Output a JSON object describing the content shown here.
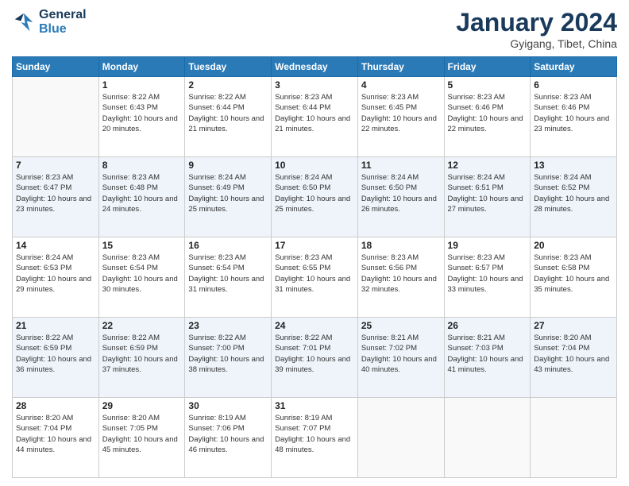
{
  "header": {
    "logo_line1": "General",
    "logo_line2": "Blue",
    "month_title": "January 2024",
    "location": "Gyigang, Tibet, China"
  },
  "days_of_week": [
    "Sunday",
    "Monday",
    "Tuesday",
    "Wednesday",
    "Thursday",
    "Friday",
    "Saturday"
  ],
  "weeks": [
    [
      {
        "day": "",
        "sunrise": "",
        "sunset": "",
        "daylight": ""
      },
      {
        "day": "1",
        "sunrise": "Sunrise: 8:22 AM",
        "sunset": "Sunset: 6:43 PM",
        "daylight": "Daylight: 10 hours and 20 minutes."
      },
      {
        "day": "2",
        "sunrise": "Sunrise: 8:22 AM",
        "sunset": "Sunset: 6:44 PM",
        "daylight": "Daylight: 10 hours and 21 minutes."
      },
      {
        "day": "3",
        "sunrise": "Sunrise: 8:23 AM",
        "sunset": "Sunset: 6:44 PM",
        "daylight": "Daylight: 10 hours and 21 minutes."
      },
      {
        "day": "4",
        "sunrise": "Sunrise: 8:23 AM",
        "sunset": "Sunset: 6:45 PM",
        "daylight": "Daylight: 10 hours and 22 minutes."
      },
      {
        "day": "5",
        "sunrise": "Sunrise: 8:23 AM",
        "sunset": "Sunset: 6:46 PM",
        "daylight": "Daylight: 10 hours and 22 minutes."
      },
      {
        "day": "6",
        "sunrise": "Sunrise: 8:23 AM",
        "sunset": "Sunset: 6:46 PM",
        "daylight": "Daylight: 10 hours and 23 minutes."
      }
    ],
    [
      {
        "day": "7",
        "sunrise": "Sunrise: 8:23 AM",
        "sunset": "Sunset: 6:47 PM",
        "daylight": "Daylight: 10 hours and 23 minutes."
      },
      {
        "day": "8",
        "sunrise": "Sunrise: 8:23 AM",
        "sunset": "Sunset: 6:48 PM",
        "daylight": "Daylight: 10 hours and 24 minutes."
      },
      {
        "day": "9",
        "sunrise": "Sunrise: 8:24 AM",
        "sunset": "Sunset: 6:49 PM",
        "daylight": "Daylight: 10 hours and 25 minutes."
      },
      {
        "day": "10",
        "sunrise": "Sunrise: 8:24 AM",
        "sunset": "Sunset: 6:50 PM",
        "daylight": "Daylight: 10 hours and 25 minutes."
      },
      {
        "day": "11",
        "sunrise": "Sunrise: 8:24 AM",
        "sunset": "Sunset: 6:50 PM",
        "daylight": "Daylight: 10 hours and 26 minutes."
      },
      {
        "day": "12",
        "sunrise": "Sunrise: 8:24 AM",
        "sunset": "Sunset: 6:51 PM",
        "daylight": "Daylight: 10 hours and 27 minutes."
      },
      {
        "day": "13",
        "sunrise": "Sunrise: 8:24 AM",
        "sunset": "Sunset: 6:52 PM",
        "daylight": "Daylight: 10 hours and 28 minutes."
      }
    ],
    [
      {
        "day": "14",
        "sunrise": "Sunrise: 8:24 AM",
        "sunset": "Sunset: 6:53 PM",
        "daylight": "Daylight: 10 hours and 29 minutes."
      },
      {
        "day": "15",
        "sunrise": "Sunrise: 8:23 AM",
        "sunset": "Sunset: 6:54 PM",
        "daylight": "Daylight: 10 hours and 30 minutes."
      },
      {
        "day": "16",
        "sunrise": "Sunrise: 8:23 AM",
        "sunset": "Sunset: 6:54 PM",
        "daylight": "Daylight: 10 hours and 31 minutes."
      },
      {
        "day": "17",
        "sunrise": "Sunrise: 8:23 AM",
        "sunset": "Sunset: 6:55 PM",
        "daylight": "Daylight: 10 hours and 31 minutes."
      },
      {
        "day": "18",
        "sunrise": "Sunrise: 8:23 AM",
        "sunset": "Sunset: 6:56 PM",
        "daylight": "Daylight: 10 hours and 32 minutes."
      },
      {
        "day": "19",
        "sunrise": "Sunrise: 8:23 AM",
        "sunset": "Sunset: 6:57 PM",
        "daylight": "Daylight: 10 hours and 33 minutes."
      },
      {
        "day": "20",
        "sunrise": "Sunrise: 8:23 AM",
        "sunset": "Sunset: 6:58 PM",
        "daylight": "Daylight: 10 hours and 35 minutes."
      }
    ],
    [
      {
        "day": "21",
        "sunrise": "Sunrise: 8:22 AM",
        "sunset": "Sunset: 6:59 PM",
        "daylight": "Daylight: 10 hours and 36 minutes."
      },
      {
        "day": "22",
        "sunrise": "Sunrise: 8:22 AM",
        "sunset": "Sunset: 6:59 PM",
        "daylight": "Daylight: 10 hours and 37 minutes."
      },
      {
        "day": "23",
        "sunrise": "Sunrise: 8:22 AM",
        "sunset": "Sunset: 7:00 PM",
        "daylight": "Daylight: 10 hours and 38 minutes."
      },
      {
        "day": "24",
        "sunrise": "Sunrise: 8:22 AM",
        "sunset": "Sunset: 7:01 PM",
        "daylight": "Daylight: 10 hours and 39 minutes."
      },
      {
        "day": "25",
        "sunrise": "Sunrise: 8:21 AM",
        "sunset": "Sunset: 7:02 PM",
        "daylight": "Daylight: 10 hours and 40 minutes."
      },
      {
        "day": "26",
        "sunrise": "Sunrise: 8:21 AM",
        "sunset": "Sunset: 7:03 PM",
        "daylight": "Daylight: 10 hours and 41 minutes."
      },
      {
        "day": "27",
        "sunrise": "Sunrise: 8:20 AM",
        "sunset": "Sunset: 7:04 PM",
        "daylight": "Daylight: 10 hours and 43 minutes."
      }
    ],
    [
      {
        "day": "28",
        "sunrise": "Sunrise: 8:20 AM",
        "sunset": "Sunset: 7:04 PM",
        "daylight": "Daylight: 10 hours and 44 minutes."
      },
      {
        "day": "29",
        "sunrise": "Sunrise: 8:20 AM",
        "sunset": "Sunset: 7:05 PM",
        "daylight": "Daylight: 10 hours and 45 minutes."
      },
      {
        "day": "30",
        "sunrise": "Sunrise: 8:19 AM",
        "sunset": "Sunset: 7:06 PM",
        "daylight": "Daylight: 10 hours and 46 minutes."
      },
      {
        "day": "31",
        "sunrise": "Sunrise: 8:19 AM",
        "sunset": "Sunset: 7:07 PM",
        "daylight": "Daylight: 10 hours and 48 minutes."
      },
      {
        "day": "",
        "sunrise": "",
        "sunset": "",
        "daylight": ""
      },
      {
        "day": "",
        "sunrise": "",
        "sunset": "",
        "daylight": ""
      },
      {
        "day": "",
        "sunrise": "",
        "sunset": "",
        "daylight": ""
      }
    ]
  ]
}
